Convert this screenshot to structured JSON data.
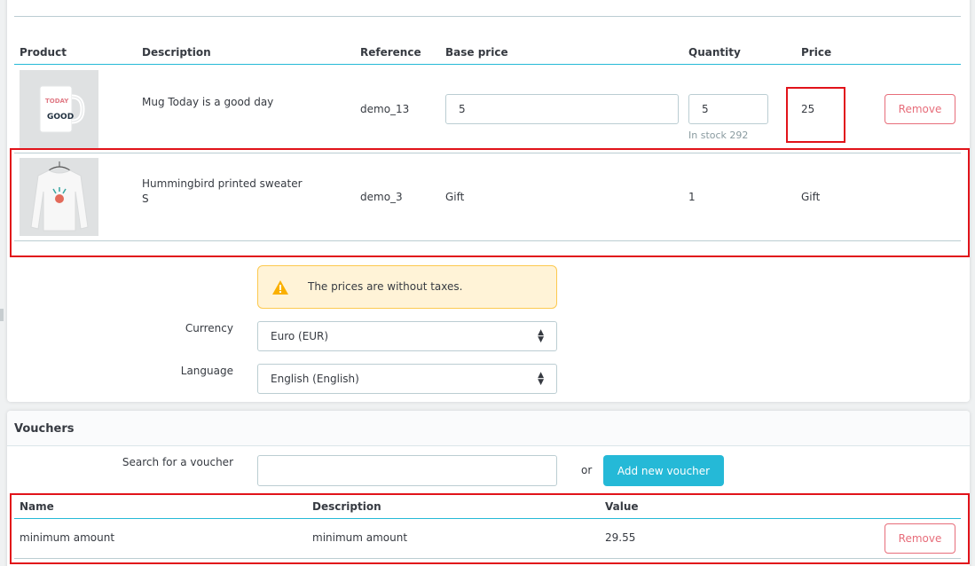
{
  "cart": {
    "headers": {
      "product": "Product",
      "description": "Description",
      "reference": "Reference",
      "base_price": "Base price",
      "quantity": "Quantity",
      "price": "Price"
    },
    "rows": [
      {
        "image": "mug-image",
        "image_text_1": "TODAY",
        "image_text_2": "GOOD",
        "description": "Mug Today is a good day",
        "reference": "demo_13",
        "base_price": "5",
        "quantity": "5",
        "stock": "In stock 292",
        "price": "25",
        "remove": "Remove"
      },
      {
        "image": "sweater-image",
        "description": "Hummingbird printed sweater",
        "variant": "S",
        "reference": "demo_3",
        "base_price": "Gift",
        "quantity": "1",
        "price": "Gift"
      }
    ]
  },
  "alert": {
    "text": "The prices are without taxes.",
    "icon": "warning-icon"
  },
  "currency": {
    "label": "Currency",
    "value": "Euro (EUR)"
  },
  "language": {
    "label": "Language",
    "value": "English (English)"
  },
  "vouchers": {
    "title": "Vouchers",
    "search_label": "Search for a voucher",
    "search_value": "",
    "or": "or",
    "add_button": "Add new voucher",
    "headers": {
      "name": "Name",
      "description": "Description",
      "value": "Value"
    },
    "rows": [
      {
        "name": "minimum amount",
        "description": "minimum amount",
        "value": "29.55",
        "remove": "Remove"
      }
    ]
  },
  "colors": {
    "accent": "#25b9d7",
    "danger": "#e76d7a",
    "highlight": "#e1131a",
    "warning_bg": "#fff3d7"
  }
}
